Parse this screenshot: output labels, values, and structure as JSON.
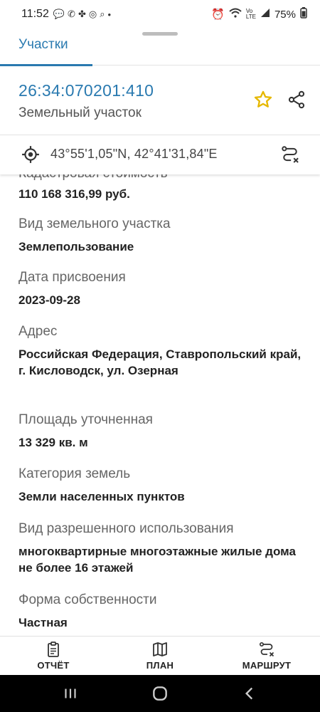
{
  "status_bar": {
    "time": "11:52",
    "notification_icons": [
      "chat-icon",
      "whatsapp-icon",
      "fan-icon",
      "instagram-icon",
      "search-icon",
      "dot-icon"
    ],
    "system_icons": [
      "alarm-icon",
      "wifi-icon",
      "volte-icon",
      "signal-icon"
    ],
    "battery": "75%"
  },
  "tabs": {
    "active": "Участки"
  },
  "parcel": {
    "cadastral_number": "26:34:070201:410",
    "type": "Земельный участок"
  },
  "coordinates": "43°55'1,05\"N, 42°41'31,84\"E",
  "details": {
    "cut_label": "Кадастровая стоимость",
    "cost_value": "110 168 316,99 руб.",
    "fields": [
      {
        "label": "Вид земельного участка",
        "value": "Землепользование"
      },
      {
        "label": "Дата присвоения",
        "value": "2023-09-28"
      },
      {
        "label": "Адрес",
        "value": "Российская Федерация, Ставропольский край, г. Кисловодск, ул. Озерная"
      },
      {
        "label": "Площадь уточненная",
        "value": "13 329 кв. м"
      },
      {
        "label": "Категория земель",
        "value": "Земли населенных пунктов"
      },
      {
        "label": "Вид разрешенного использования",
        "value": "многоквартирные многоэтажные жилые дома не более 16 этажей"
      },
      {
        "label": "Форма собственности",
        "value": "Частная"
      }
    ]
  },
  "bottom_nav": {
    "report": "ОТЧЁТ",
    "plan": "ПЛАН",
    "route": "МАРШРУТ"
  },
  "colors": {
    "accent": "#2a7ab0",
    "star": "#e6b800"
  }
}
